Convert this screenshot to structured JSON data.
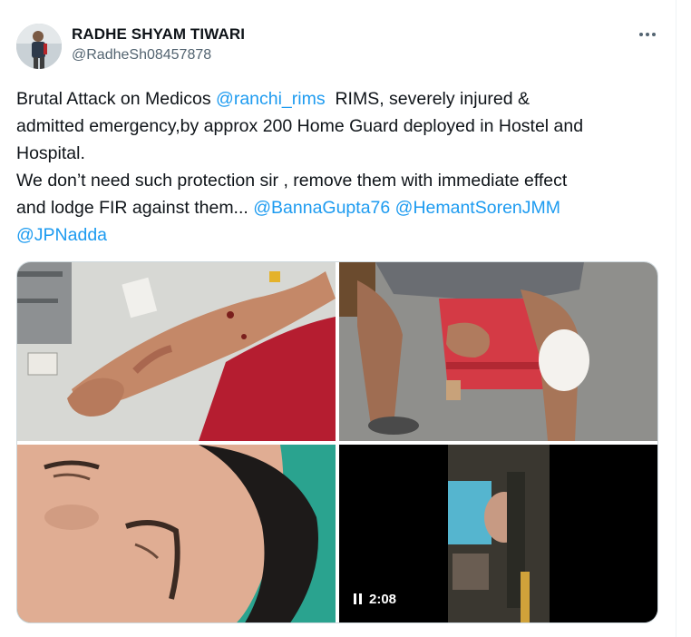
{
  "author": {
    "name": "RADHE SHYAM TIWARI",
    "handle": "@RadheSh08457878"
  },
  "menu_icon": "more-horizontal-icon",
  "tweet": {
    "line1_a": "Brutal Attack on Medicos ",
    "line1_mention": "@ranchi_rims",
    "line1_b": "  RIMS, severely injured &",
    "line2": "admitted emergency,by approx 200 Home Guard deployed in Hostel and",
    "line3": "Hospital.",
    "line4": "We don’t need such protection sir , remove them with immediate effect",
    "line5_a": "and lodge FIR against them... ",
    "mention2": "@BannaGupta76",
    "mention3": "@HemantSorenJMM",
    "mention4": "@JPNadda"
  },
  "media": {
    "video_duration": "2:08",
    "video_state_icon": "pause-icon",
    "colors": {
      "mention": "#1d9bf0",
      "border": "#cfd9de"
    }
  }
}
